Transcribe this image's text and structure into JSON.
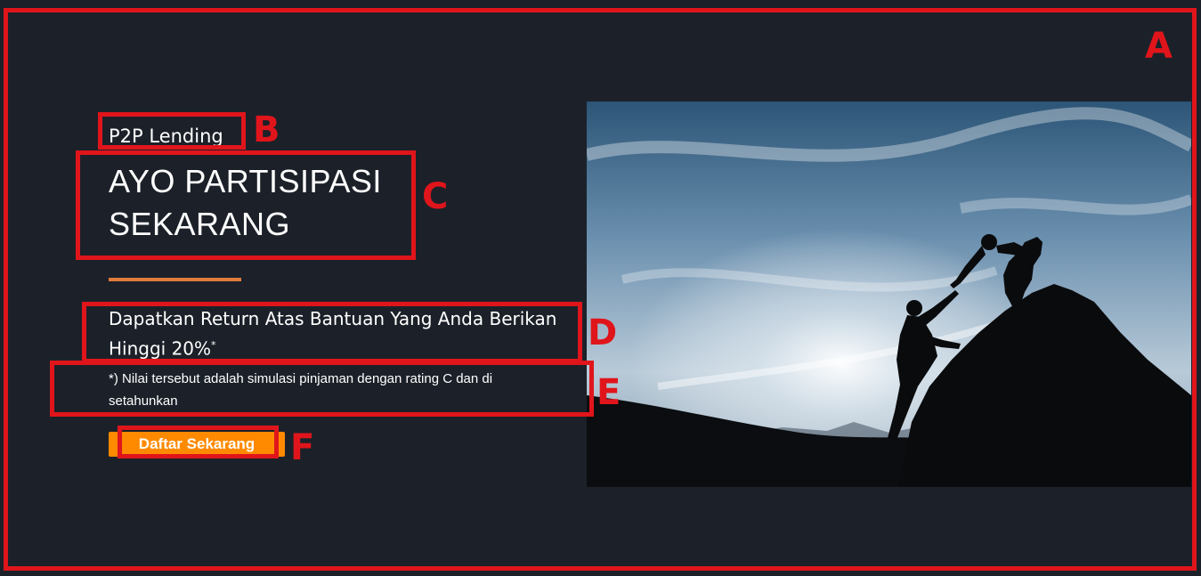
{
  "hero": {
    "eyebrow": "P2P Lending",
    "title_line1": "AYO PARTISIPASI",
    "title_line2": "SEKARANG",
    "subtitle_main": "Dapatkan Return Atas Bantuan Yang Anda Berikan Hinggi 20%",
    "subtitle_mark": "*",
    "note": "*) Nilai tersebut adalah simulasi pinjaman dengan rating C dan di setahunkan",
    "cta_label": "Daftar Sekarang",
    "accent_color": "#e07b3a",
    "cta_color": "#ff8a00",
    "background_color": "#1c2129",
    "image_icon": "climbers-helping-hand-photo"
  },
  "annotations": {
    "color": "#e0151b",
    "labels": [
      "A",
      "B",
      "C",
      "D",
      "E",
      "F"
    ]
  }
}
